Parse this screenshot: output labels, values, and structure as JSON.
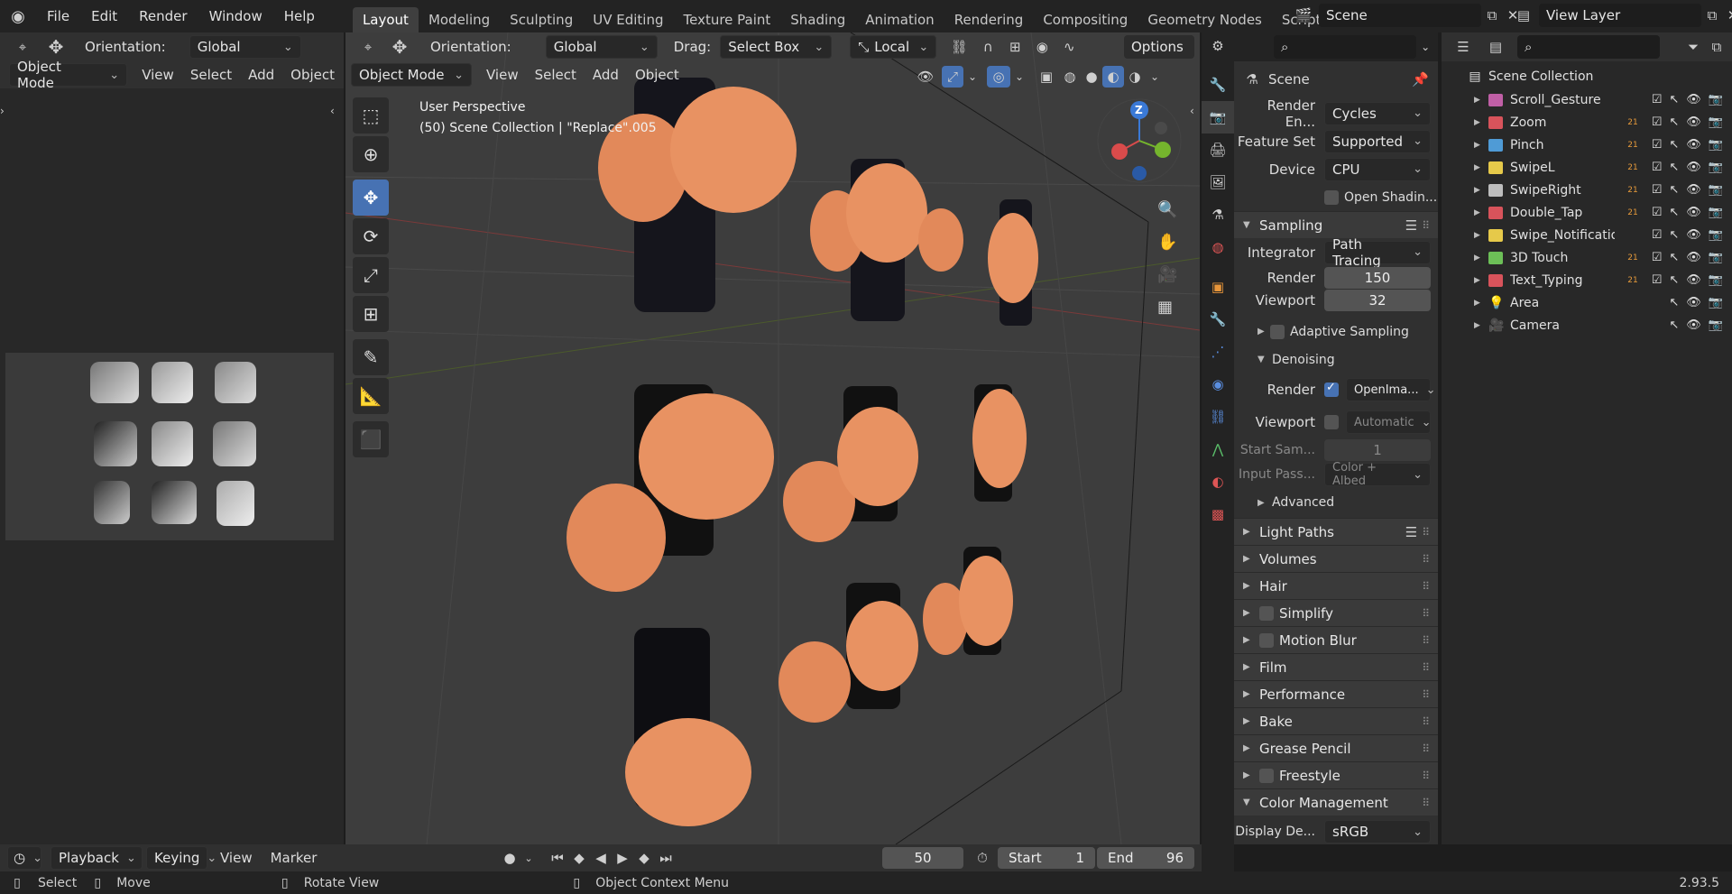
{
  "topbar": {
    "menus": [
      "File",
      "Edit",
      "Render",
      "Window",
      "Help"
    ],
    "workspaces": [
      "Layout",
      "Modeling",
      "Sculpting",
      "UV Editing",
      "Texture Paint",
      "Shading",
      "Animation",
      "Rendering",
      "Compositing",
      "Geometry Nodes",
      "Scripting"
    ],
    "add_tab": "+",
    "scene": "Scene",
    "view_layer": "View Layer"
  },
  "left_editor": {
    "orientation_label": "Orientation:",
    "orientation_value": "Global",
    "mode": "Object Mode",
    "menus": [
      "View",
      "Select",
      "Add",
      "Object"
    ]
  },
  "viewport": {
    "orientation_label": "Orientation:",
    "orientation_value": "Global",
    "drag_label": "Drag:",
    "drag_value": "Select Box",
    "transform_pivot": "Local",
    "options": "Options",
    "mode": "Object Mode",
    "menus": [
      "View",
      "Select",
      "Add",
      "Object"
    ],
    "overlay_title": "User Perspective",
    "overlay_sub": "(50) Scene Collection | \"Replace\".005",
    "gizmo_z": "Z"
  },
  "properties": {
    "title": "Scene",
    "render_engine_label": "Render En...",
    "render_engine": "Cycles",
    "feature_set_label": "Feature Set",
    "feature_set": "Supported",
    "device_label": "Device",
    "device": "CPU",
    "open_shading": "Open Shadin...",
    "sampling": "Sampling",
    "integrator_label": "Integrator",
    "integrator": "Path Tracing",
    "render_label": "Render",
    "render_samples": "150",
    "viewport_label": "Viewport",
    "viewport_samples": "32",
    "adaptive_sampling": "Adaptive Sampling",
    "denoising": "Denoising",
    "den_render_label": "Render",
    "den_render_value": "OpenIma...",
    "den_viewport_label": "Viewport",
    "den_viewport_value": "Automatic",
    "start_sam_label": "Start Sam...",
    "start_sam_value": "1",
    "input_pass_label": "Input Pass...",
    "input_pass_value": "Color + Albed",
    "advanced": "Advanced",
    "light_paths": "Light Paths",
    "volumes": "Volumes",
    "hair": "Hair",
    "simplify": "Simplify",
    "motion_blur": "Motion Blur",
    "film": "Film",
    "performance": "Performance",
    "bake": "Bake",
    "grease_pencil": "Grease Pencil",
    "freestyle": "Freestyle",
    "color_management": "Color Management",
    "display_device_label": "Display De...",
    "display_device": "sRGB"
  },
  "outliner": {
    "root": "Scene Collection",
    "items": [
      {
        "name": "Scroll_Gesture",
        "color": "#c05fa6",
        "badge": ""
      },
      {
        "name": "Zoom",
        "color": "#d8535b",
        "badge": "21"
      },
      {
        "name": "Pinch",
        "color": "#4f9bd6",
        "badge": "21"
      },
      {
        "name": "SwipeL",
        "color": "#e6c94a",
        "badge": "21"
      },
      {
        "name": "SwipeRight",
        "color": "#bdbdbd",
        "badge": "21"
      },
      {
        "name": "Double_Tap",
        "color": "#d8535b",
        "badge": "21"
      },
      {
        "name": "Swipe_Notifications",
        "color": "#e6c94a",
        "badge": ""
      },
      {
        "name": "3D Touch",
        "color": "#6cbf57",
        "badge": "21"
      },
      {
        "name": "Text_Typing",
        "color": "#d8535b",
        "badge": "21"
      },
      {
        "name": "Area",
        "color": "#e89b3b",
        "badge": ""
      },
      {
        "name": "Camera",
        "color": "#e89b3b",
        "badge": ""
      }
    ]
  },
  "timeline": {
    "menus": [
      "Playback",
      "Keying",
      "View",
      "Marker"
    ],
    "current_frame": "50",
    "start_label": "Start",
    "start": "1",
    "end_label": "End",
    "end": "96"
  },
  "statusbar": {
    "select": "Select",
    "move": "Move",
    "rotate": "Rotate View",
    "context": "Object Context Menu",
    "version": "2.93.5"
  }
}
